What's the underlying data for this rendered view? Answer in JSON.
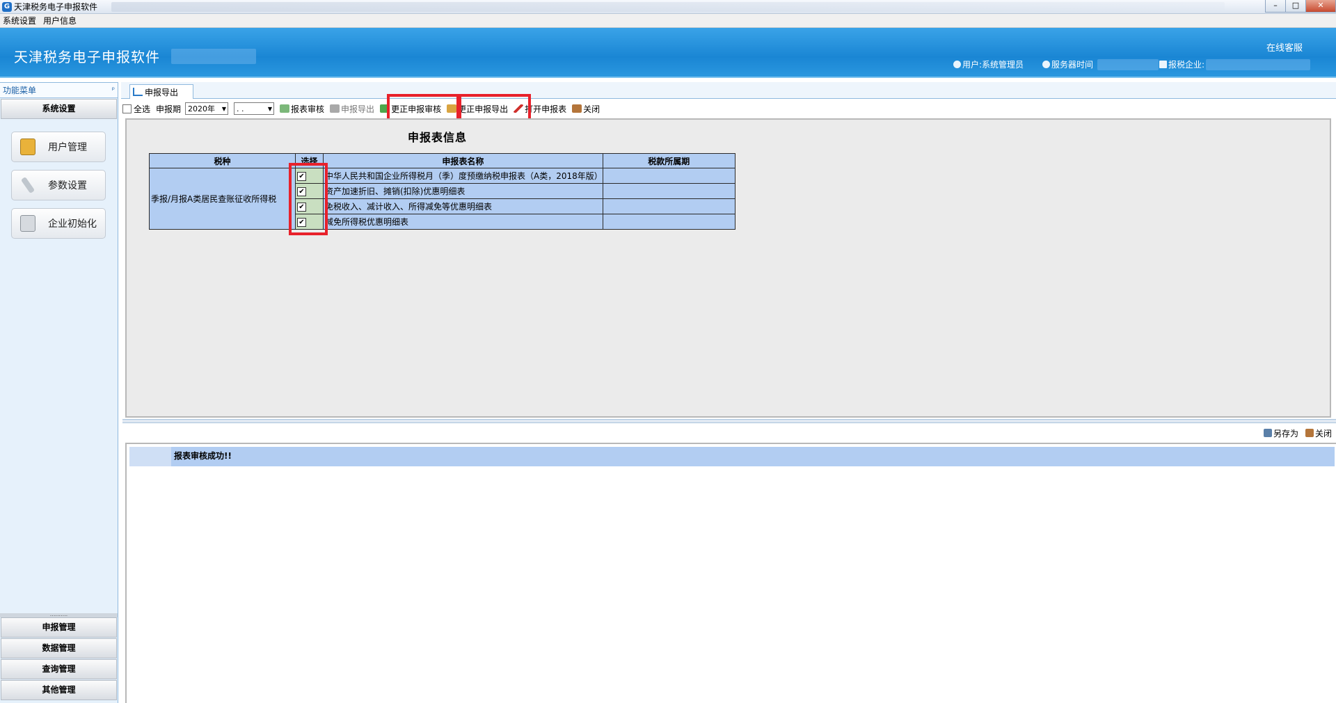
{
  "window": {
    "title": "天津税务电子申报软件",
    "buttons": [
      "–",
      "□",
      "✕"
    ]
  },
  "menubar": [
    "系统设置",
    "用户信息"
  ],
  "header": {
    "app_name": "天津税务电子申报软件",
    "online_service": "在线客服",
    "user_label": "用户:系统管理员",
    "server_time_label": "服务器时间",
    "tax_company_label": "报税企业:"
  },
  "sidebar": {
    "title": "功能菜单",
    "pin": "ᵖ",
    "active_section": "系统设置",
    "tools": [
      {
        "label": "用户管理",
        "icon": "contact-book-icon",
        "color": "#e9b23a"
      },
      {
        "label": "参数设置",
        "icon": "wrench-icon",
        "color": "#9aa4ad"
      },
      {
        "label": "企业初始化",
        "icon": "clipboard-icon",
        "color": "#a8aeb6"
      }
    ],
    "grip": "..........",
    "sections": [
      "申报管理",
      "数据管理",
      "查询管理",
      "其他管理"
    ]
  },
  "tab": {
    "label": "申报导出",
    "icon": "edit-icon"
  },
  "toolbar": {
    "select_all": "全选",
    "period_label": "申报期",
    "year_value": "2020年",
    "month_value": ". .",
    "report_check": "报表审核",
    "report_export": "申报导出",
    "correct_check": "更正申报审核",
    "correct_export": "更正申报导出",
    "open_report": "打开申报表",
    "close": "关闭"
  },
  "content": {
    "title": "申报表信息",
    "columns": [
      "税种",
      "选择",
      "申报表名称",
      "税款所属期"
    ],
    "tax_type": "季报/月报A类居民查账征收所得税",
    "rows": [
      {
        "checked": "✔",
        "name": "中华人民共和国企业所得税月（季）度预缴纳税申报表（A类，2018年版）"
      },
      {
        "checked": "✔",
        "name": "资产加速折旧、摊销(扣除)优惠明细表"
      },
      {
        "checked": "✔",
        "name": "免税收入、减计收入、所得减免等优惠明细表"
      },
      {
        "checked": "✔",
        "name": "减免所得税优惠明细表"
      }
    ]
  },
  "lower": {
    "save_as": "另存为",
    "close": "关闭",
    "log_message": "报表审核成功!!"
  }
}
